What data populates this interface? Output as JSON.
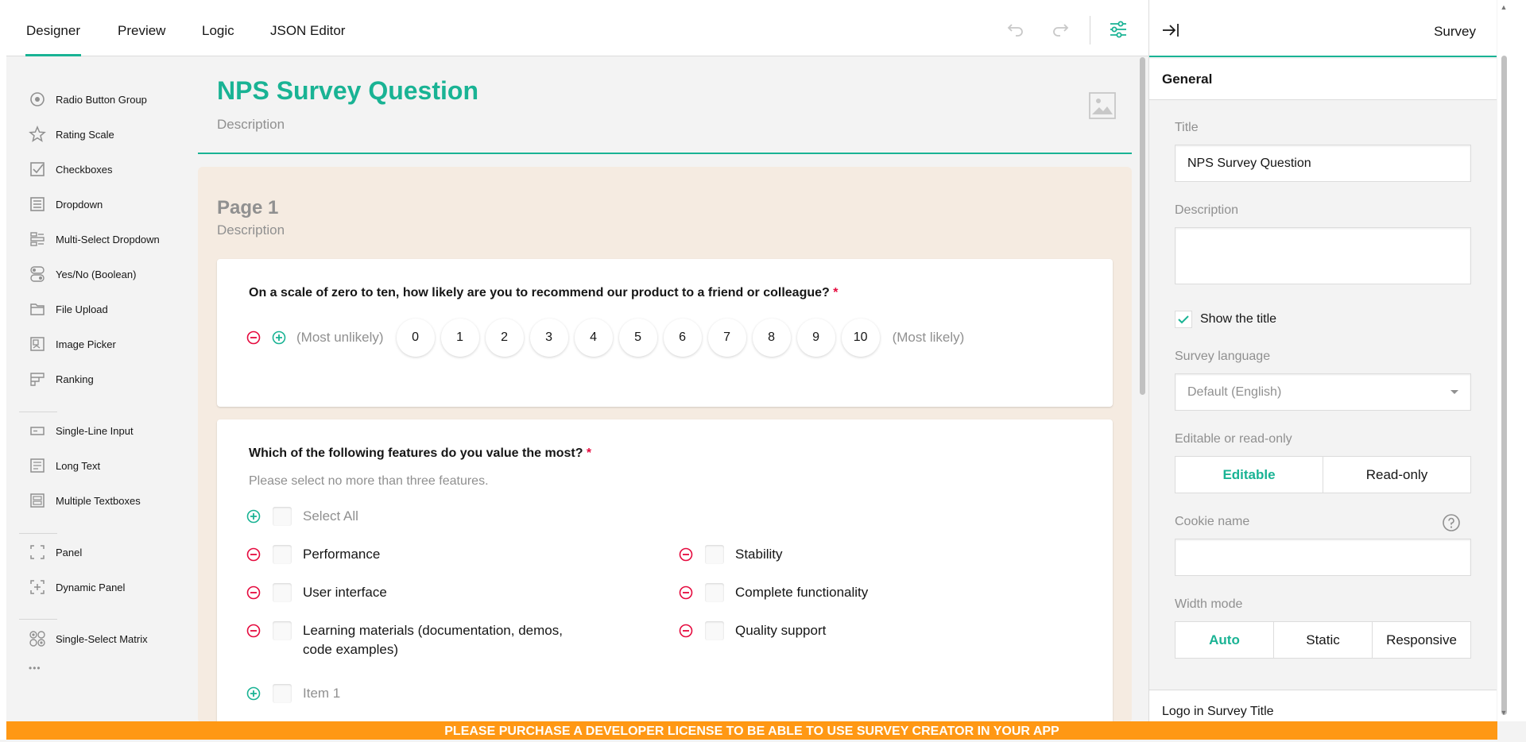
{
  "tabs": [
    {
      "label": "Designer",
      "active": true
    },
    {
      "label": "Preview"
    },
    {
      "label": "Logic"
    },
    {
      "label": "JSON Editor"
    }
  ],
  "toolbox": {
    "items": [
      {
        "label": "Radio Button Group",
        "icon": "radio-group-icon"
      },
      {
        "label": "Rating Scale",
        "icon": "star-icon"
      },
      {
        "label": "Checkboxes",
        "icon": "checkbox-icon"
      },
      {
        "label": "Dropdown",
        "icon": "dropdown-icon"
      },
      {
        "label": "Multi-Select Dropdown",
        "icon": "tagbox-icon"
      },
      {
        "label": "Yes/No (Boolean)",
        "icon": "boolean-icon"
      },
      {
        "label": "File Upload",
        "icon": "folder-icon"
      },
      {
        "label": "Image Picker",
        "icon": "image-picker-icon"
      },
      {
        "label": "Ranking",
        "icon": "ranking-icon"
      },
      {
        "label": "Single-Line Input",
        "icon": "text-input-icon"
      },
      {
        "label": "Long Text",
        "icon": "comment-icon"
      },
      {
        "label": "Multiple Textboxes",
        "icon": "multiple-text-icon"
      },
      {
        "label": "Panel",
        "icon": "panel-icon"
      },
      {
        "label": "Dynamic Panel",
        "icon": "dynamic-panel-icon"
      },
      {
        "label": "Single-Select Matrix",
        "icon": "matrix-icon"
      }
    ],
    "more": "•••"
  },
  "survey": {
    "title": "NPS Survey Question",
    "description": "Description"
  },
  "page": {
    "title": "Page 1",
    "description": "Description"
  },
  "q1": {
    "title": "On a scale of zero to ten, how likely are you to recommend our product to a friend or colleague?",
    "required": "*",
    "min_label": "(Most unlikely)",
    "max_label": "(Most likely)",
    "rates": [
      "0",
      "1",
      "2",
      "3",
      "4",
      "5",
      "6",
      "7",
      "8",
      "9",
      "10"
    ]
  },
  "q2": {
    "title": "Which of the following features do you value the most?",
    "required": "*",
    "description": "Please select no more than three features.",
    "select_all": "Select All",
    "choices": [
      "Performance",
      "Stability",
      "User interface",
      "Complete functionality",
      "Learning materials (documentation, demos, code examples)",
      "Quality support"
    ],
    "new_item": "Item 1"
  },
  "props": {
    "header": "Survey",
    "section": "General",
    "title_label": "Title",
    "title_value": "NPS Survey Question",
    "desc_label": "Description",
    "desc_value": "",
    "show_title": "Show the title",
    "lang_label": "Survey language",
    "lang_value": "Default (English)",
    "mode_label": "Editable or read-only",
    "mode_options": [
      "Editable",
      "Read-only"
    ],
    "mode_selected": "Editable",
    "cookie_label": "Cookie name",
    "cookie_value": "",
    "width_label": "Width mode",
    "width_options": [
      "Auto",
      "Static",
      "Responsive"
    ],
    "width_selected": "Auto",
    "logo_section": "Logo in Survey Title"
  },
  "banner": "PLEASE PURCHASE A DEVELOPER LICENSE TO BE ABLE TO USE SURVEY CREATOR IN YOUR APP",
  "colors": {
    "accent": "#19b394",
    "required": "#e50a3e",
    "banner": "#ff9814",
    "page_bg": "#f5ebe1"
  }
}
